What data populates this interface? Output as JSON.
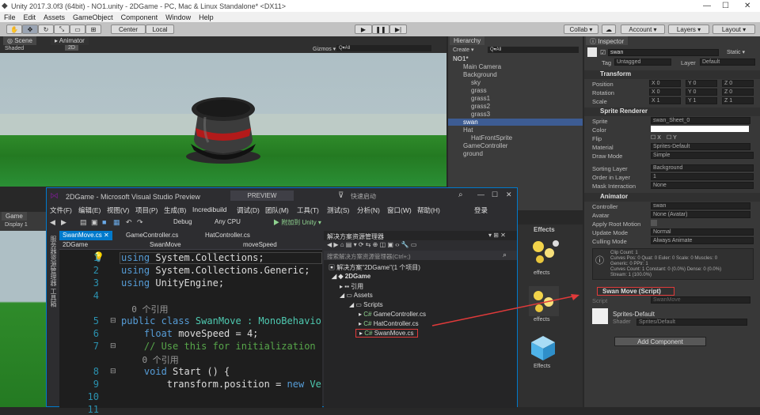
{
  "unity": {
    "title": "Unity 2017.3.0f3 (64bit) - NO1.unity - 2DGame - PC, Mac & Linux Standalone* <DX11>",
    "menu": [
      "File",
      "Edit",
      "Assets",
      "GameObject",
      "Component",
      "Window",
      "Help"
    ],
    "toolbar": {
      "center": "Center",
      "local": "Local",
      "collab": "Collab ▾",
      "account": "Account ▾",
      "layers": "Layers ▾",
      "layout": "Layout ▾"
    },
    "scene_tab": "Scene",
    "animator_tab": "Animator",
    "shaded": "Shaded",
    "mode2d": "2D",
    "gizmos": "Gizmos ▾",
    "search_all": "Q▾All",
    "game_tab": "Game",
    "display": "Display 1",
    "hierarchy": {
      "tab": "Hierarchy",
      "create": "Create ▾",
      "search": "Q▾All",
      "items": [
        {
          "label": "NO1*",
          "depth": 0
        },
        {
          "label": "Main Camera",
          "depth": 1
        },
        {
          "label": "Background",
          "depth": 1
        },
        {
          "label": "sky",
          "depth": 2
        },
        {
          "label": "grass",
          "depth": 2
        },
        {
          "label": "grass1",
          "depth": 2
        },
        {
          "label": "grass2",
          "depth": 2
        },
        {
          "label": "grass3",
          "depth": 2
        },
        {
          "label": "swan",
          "depth": 1,
          "selected": true
        },
        {
          "label": "Hat",
          "depth": 1
        },
        {
          "label": "HatFrontSprite",
          "depth": 2
        },
        {
          "label": "GameController",
          "depth": 1
        },
        {
          "label": "ground",
          "depth": 1
        }
      ]
    },
    "project": {
      "label": "Effects",
      "items": [
        "effects",
        "effects",
        "Effects"
      ]
    },
    "inspector": {
      "tab": "Inspector",
      "name": "swan",
      "static": "Static ▾",
      "tag_label": "Tag",
      "tag": "Untagged",
      "layer_label": "Layer",
      "layer": "Default",
      "transform": {
        "title": "Transform",
        "rows": [
          {
            "label": "Position",
            "x": "0",
            "y": "0",
            "z": "0"
          },
          {
            "label": "Rotation",
            "x": "0",
            "y": "0",
            "z": "0"
          },
          {
            "label": "Scale",
            "x": "1",
            "y": "1",
            "z": "1"
          }
        ]
      },
      "sprite_renderer": {
        "title": "Sprite Renderer",
        "sprite_label": "Sprite",
        "sprite": "swan_Sheet_0",
        "color_label": "Color",
        "flip_label": "Flip",
        "flip_x": "X",
        "flip_y": "Y",
        "material_label": "Material",
        "material": "Sprites-Default",
        "draw_mode_label": "Draw Mode",
        "draw_mode": "Simple",
        "sorting_layer_label": "Sorting Layer",
        "sorting_layer": "Background",
        "order_label": "Order in Layer",
        "order": "1",
        "mask_label": "Mask Interaction",
        "mask": "None"
      },
      "animator": {
        "title": "Animator",
        "controller_label": "Controller",
        "controller": "swan",
        "avatar_label": "Avatar",
        "avatar": "None (Avatar)",
        "root_motion_label": "Apply Root Motion",
        "update_label": "Update Mode",
        "update": "Normal",
        "culling_label": "Culling Mode",
        "culling": "Always Animate",
        "info": [
          "Clip Count: 1",
          "Curves Pos: 0 Quat: 0 Euler: 0 Scale: 0 Muscles: 0",
          "Generic: 0 PPtr: 1",
          "Curves Count: 1 Constant: 0 (0.0%) Dense: 0 (0.0%)",
          "Stream: 1 (100.0%)"
        ]
      },
      "script": {
        "title": "Swan Move (Script)",
        "label": "Script",
        "value": "SwanMove"
      },
      "material": {
        "name": "Sprites-Default",
        "shader_label": "Shader",
        "shader": "Sprites/Default"
      },
      "add_component": "Add Component"
    }
  },
  "vs": {
    "title": "2DGame - Microsoft Visual Studio Preview",
    "preview": "PREVIEW",
    "quick_launch": "快速启动",
    "menu": [
      "文件(F)",
      "编辑(E)",
      "视图(V)",
      "项目(P)",
      "生成(B)",
      "Incredibuild",
      "调试(D)",
      "团队(M)",
      "工具(T)",
      "测试(S)",
      "分析(N)",
      "窗口(W)",
      "帮助(H)"
    ],
    "login": "登录",
    "toolbar": {
      "config": "Debug",
      "platform": "Any CPU",
      "attach": "▶ 附加到 Unity ▾"
    },
    "tabs": [
      "SwanMove.cs",
      "GameController.cs",
      "HatController.cs"
    ],
    "nav_project": "2DGame",
    "nav_class": "SwanMove",
    "nav_member": "moveSpeed",
    "side_tabs": "服务器资源管理器  工具箱",
    "lines": [
      {
        "n": "1",
        "segs": [
          {
            "t": "using",
            "c": "#569cd6"
          },
          {
            "t": " System.Collections;",
            "c": "#dcdcdc"
          }
        ]
      },
      {
        "n": "2",
        "segs": [
          {
            "t": "using",
            "c": "#569cd6"
          },
          {
            "t": " System.Collections.Generic;",
            "c": "#dcdcdc"
          }
        ]
      },
      {
        "n": "3",
        "segs": [
          {
            "t": "using",
            "c": "#569cd6"
          },
          {
            "t": " UnityEngine;",
            "c": "#dcdcdc"
          }
        ]
      },
      {
        "n": "4",
        "segs": []
      },
      {
        "n": "",
        "segs": [
          {
            "t": "  0 个引用",
            "c": "#999999"
          }
        ]
      },
      {
        "n": "5",
        "segs": [
          {
            "t": "public class ",
            "c": "#569cd6"
          },
          {
            "t": "SwanMove",
            "c": "#4ec9b0"
          },
          {
            "t": " : MonoBehavio",
            "c": "#4ec9b0"
          }
        ]
      },
      {
        "n": "6",
        "segs": [
          {
            "t": "    float",
            "c": "#569cd6"
          },
          {
            "t": " moveSpeed = 4;",
            "c": "#dcdcdc"
          }
        ]
      },
      {
        "n": "7",
        "segs": [
          {
            "t": "    // Use this for initialization",
            "c": "#57a64a"
          }
        ]
      },
      {
        "n": "",
        "segs": [
          {
            "t": "    0 个引用",
            "c": "#999999"
          }
        ]
      },
      {
        "n": "8",
        "segs": [
          {
            "t": "    void",
            "c": "#569cd6"
          },
          {
            "t": " Start () {",
            "c": "#dcdcdc"
          }
        ]
      },
      {
        "n": "9",
        "segs": [
          {
            "t": "        transform.position = ",
            "c": "#dcdcdc"
          },
          {
            "t": "new",
            "c": "#569cd6"
          },
          {
            "t": " Ve",
            "c": "#4ec9b0"
          }
        ]
      },
      {
        "n": "10",
        "segs": []
      },
      {
        "n": "11",
        "segs": []
      }
    ],
    "solution": {
      "title": "解决方案资源管理器",
      "search": "搜索解决方案资源管理器(Ctrl+;)",
      "items": [
        {
          "label": "解决方案\"2DGame\"(1 个项目)",
          "depth": 0
        },
        {
          "label": "2DGame",
          "depth": 1
        },
        {
          "label": "引用",
          "depth": 2
        },
        {
          "label": "Assets",
          "depth": 2
        },
        {
          "label": "Scripts",
          "depth": 3
        },
        {
          "label": "GameController.cs",
          "depth": 4
        },
        {
          "label": "HatController.cs",
          "depth": 4
        },
        {
          "label": "SwanMove.cs",
          "depth": 4
        }
      ]
    }
  },
  "colors": {
    "accent": "#007acc",
    "selection": "#3d5c93",
    "arrow": "#e03a3a",
    "grass": "#2f8b2a"
  }
}
